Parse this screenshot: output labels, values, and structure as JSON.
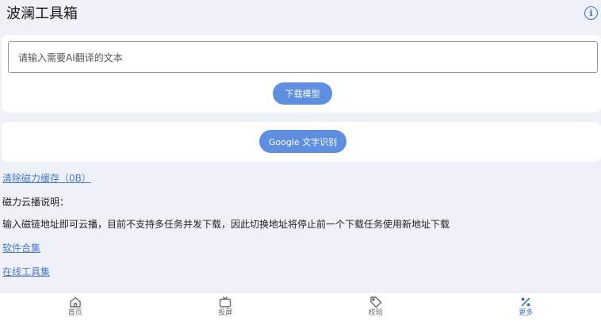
{
  "header": {
    "title": "波澜工具箱",
    "info_icon": "info-icon",
    "info_glyph": "i"
  },
  "translate_card": {
    "input_placeholder": "请输入需要AI翻译的文本",
    "download_button": "下载模型"
  },
  "ocr_card": {
    "button": "Google 文字识别"
  },
  "links": {
    "clear_cache": "清除磁力缓存（0B）",
    "software": "软件合集",
    "online_tools": "在线工具集"
  },
  "magnet": {
    "title": "磁力云播说明：",
    "description": "输入磁链地址即可云播，目前不支持多任务并发下载，因此切换地址将停止前一个下载任务使用新地址下载"
  },
  "bottom_nav": {
    "items": [
      {
        "label": "首页",
        "icon": "home-icon"
      },
      {
        "label": "投屏",
        "icon": "tv-icon"
      },
      {
        "label": "校验",
        "icon": "tag-icon"
      },
      {
        "label": "更多",
        "icon": "percent-icon",
        "active": true
      }
    ]
  },
  "colors": {
    "accent": "#5e8ee0",
    "link": "#4a79c9",
    "background": "#eef1f8"
  }
}
